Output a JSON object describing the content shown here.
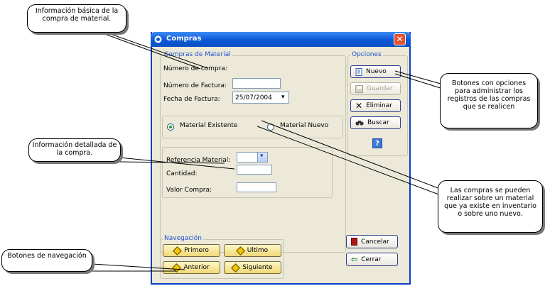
{
  "window": {
    "title": "Compras"
  },
  "compras_group": {
    "legend": "Compras de Material",
    "numero_compra_label": "Número de compra:",
    "numero_factura_label": "Número de Factura:",
    "numero_factura_value": "",
    "fecha_factura_label": "Fecha de Factura:",
    "fecha_factura_value": "25/07/2004"
  },
  "material_choice": {
    "existente_label": "Material Existente",
    "nuevo_label": "Material Nuevo"
  },
  "detalle": {
    "referencia_label": "Referencia Material:",
    "cantidad_label": "Cantidad:",
    "valor_label": "Valor Compra:"
  },
  "opciones": {
    "legend": "Opciones",
    "nuevo": "Nuevo",
    "guardar": "Guardar",
    "eliminar": "Eliminar",
    "buscar": "Buscar",
    "help": "?"
  },
  "navegacion": {
    "legend": "Navegación",
    "primero": "Primero",
    "ultimo": "Ultimo",
    "anterior": "Anterior",
    "siguiente": "Siguiente"
  },
  "actions": {
    "cancelar": "Cancelar",
    "cerrar": "Cerrar"
  },
  "callouts": {
    "basica": "Información básica de la compra de material.",
    "detallada": "Información detallada de la compra.",
    "navegacion": "Botones de navegación",
    "opciones": "Botones con opciones para administrar los registros de las compras que se realicen",
    "material": "Las compras se pueden realizar sobre un material que ya existe en inventario o sobre uno nuevo."
  }
}
